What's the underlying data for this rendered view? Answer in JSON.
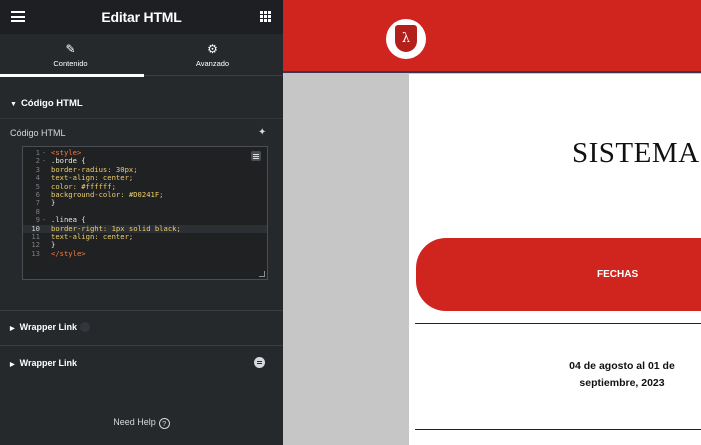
{
  "panel": {
    "title": "Editar HTML",
    "tabs": [
      {
        "label": "Contenido",
        "icon": "pencil-icon",
        "active": true
      },
      {
        "label": "Avanzado",
        "icon": "gear-icon",
        "active": false
      }
    ],
    "section_title": "Código HTML",
    "field_label": "Código HTML",
    "code_lines": [
      {
        "n": "1",
        "fold": "-",
        "text": "<style>"
      },
      {
        "n": "2",
        "fold": "-",
        "text": ".borde {"
      },
      {
        "n": "3",
        "fold": "",
        "text": "border-radius: 30px;"
      },
      {
        "n": "4",
        "fold": "",
        "text": "text-align: center;"
      },
      {
        "n": "5",
        "fold": "",
        "text": "color: #ffffff;"
      },
      {
        "n": "6",
        "fold": "",
        "text": "background-color: #D0241F;"
      },
      {
        "n": "7",
        "fold": "",
        "text": "}"
      },
      {
        "n": "8",
        "fold": "",
        "text": ""
      },
      {
        "n": "9",
        "fold": "-",
        "text": ".linea {"
      },
      {
        "n": "10",
        "fold": "",
        "text": "border-right: 1px solid black;"
      },
      {
        "n": "11",
        "fold": "",
        "text": "text-align: center;"
      },
      {
        "n": "12",
        "fold": "",
        "text": "}"
      },
      {
        "n": "13",
        "fold": "",
        "text": "</style>"
      }
    ],
    "wrapper_link_1": "Wrapper Link",
    "wrapper_link_2": "Wrapper Link",
    "need_help": "Need Help",
    "help_icon": "?"
  },
  "preview": {
    "heading": "SISTEMA",
    "fechas_label": "FECHAS",
    "date_range": "04 de agosto al 01 de septiembre, 2023",
    "colors": {
      "brand_red": "#D0241F",
      "panel_dark": "#26292c"
    }
  }
}
